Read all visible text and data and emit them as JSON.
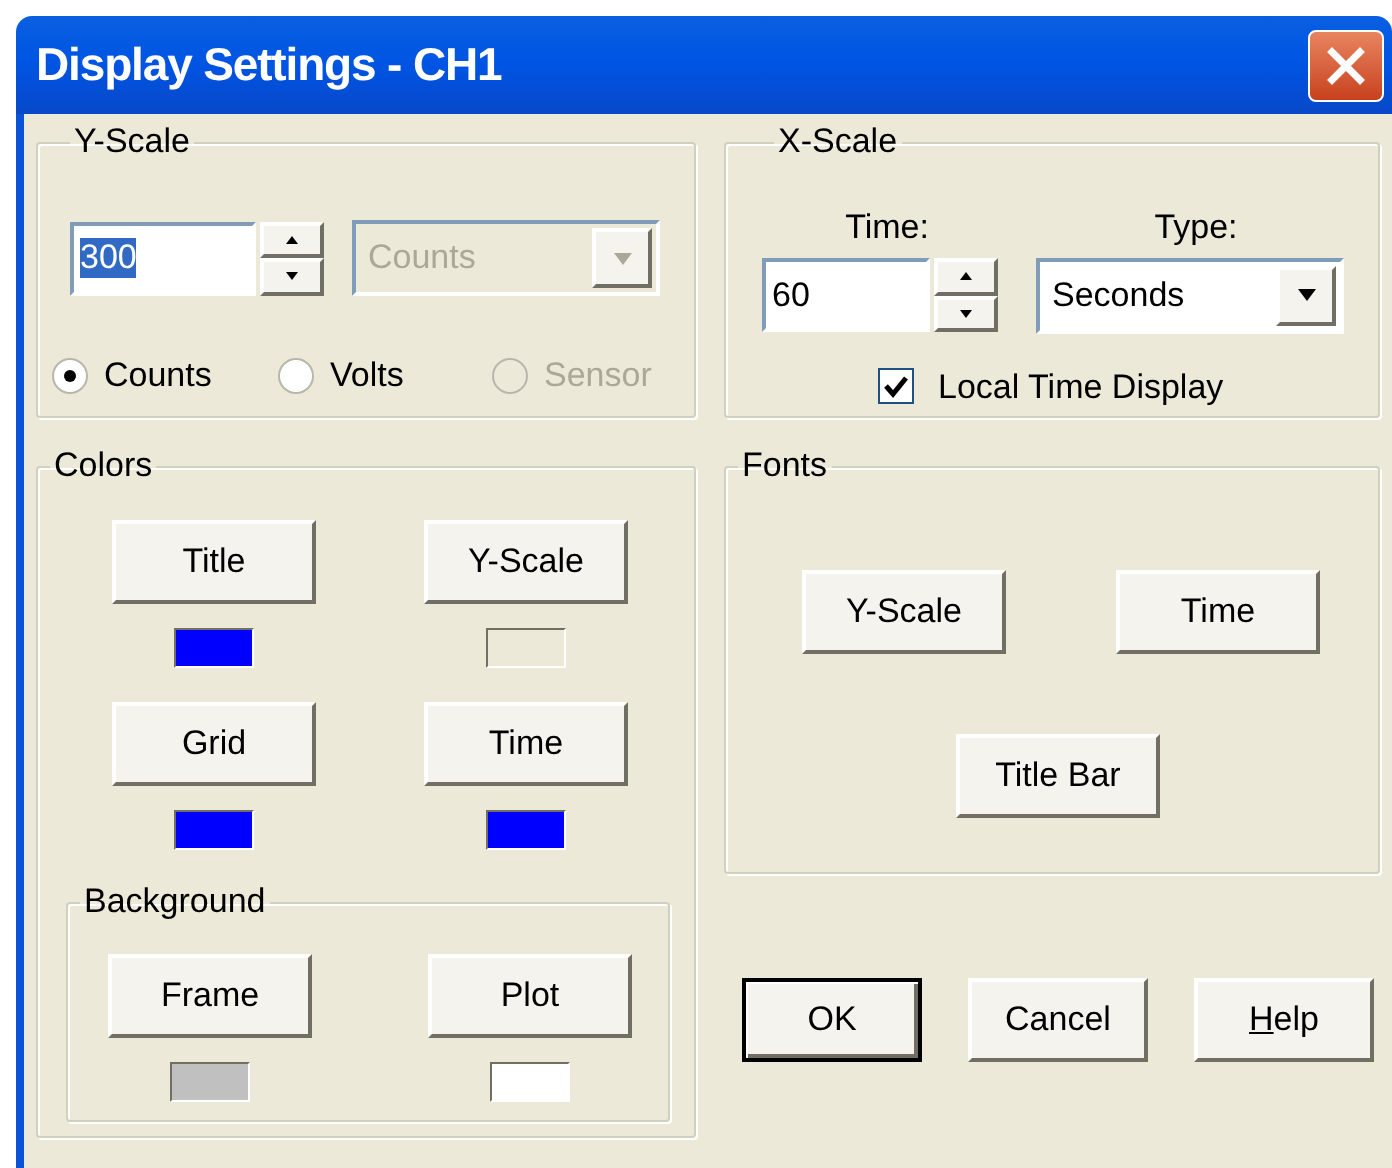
{
  "window": {
    "title": "Display Settings - CH1"
  },
  "y_scale": {
    "label": "Y-Scale",
    "value": "300",
    "value_selected": true,
    "unit": {
      "value": "Counts",
      "disabled": true
    },
    "modes": [
      {
        "label": "Counts",
        "selected": true,
        "disabled": false
      },
      {
        "label": "Volts",
        "selected": false,
        "disabled": false
      },
      {
        "label": "Sensor",
        "selected": false,
        "disabled": true
      }
    ]
  },
  "x_scale": {
    "label": "X-Scale",
    "time": {
      "label": "Time:",
      "value": "60"
    },
    "type": {
      "label": "Type:",
      "value": "Seconds",
      "disabled": false
    },
    "local_time_display": {
      "label": "Local Time Display",
      "checked": true
    }
  },
  "colors": {
    "label": "Colors",
    "items": [
      {
        "label": "Title",
        "color": "#0000ff"
      },
      {
        "label": "Y-Scale",
        "color": "#ece9d8"
      },
      {
        "label": "Grid",
        "color": "#0000ff"
      },
      {
        "label": "Time",
        "color": "#0000ff"
      }
    ],
    "background": {
      "label": "Background",
      "items": [
        {
          "label": "Frame",
          "color": "#c0c0c0"
        },
        {
          "label": "Plot",
          "color": "#ffffff"
        }
      ]
    }
  },
  "fonts": {
    "label": "Fonts",
    "buttons": [
      "Y-Scale",
      "Time",
      "Title Bar"
    ]
  },
  "buttons": [
    {
      "label": "OK",
      "default": true,
      "underline_first": false
    },
    {
      "label": "Cancel",
      "default": false,
      "underline_first": false
    },
    {
      "label": "Help",
      "default": false,
      "underline_first": true
    }
  ]
}
